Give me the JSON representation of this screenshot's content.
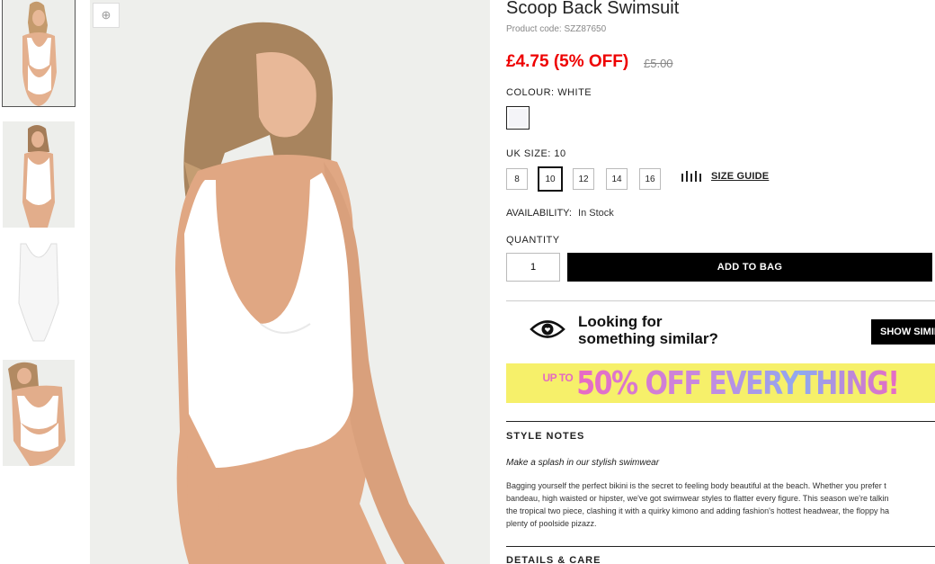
{
  "gallery": {
    "thumbnails": [
      {
        "alt": "Back view"
      },
      {
        "alt": "Front view"
      },
      {
        "alt": "Flat lay"
      },
      {
        "alt": "Side back view"
      }
    ],
    "zoom_icon": "zoom-in-icon",
    "zoom_glyph": "⊕"
  },
  "product": {
    "title": "Scoop Back Swimsuit",
    "product_code": "Product code: SZZ87650",
    "price": "£4.75 (5% OFF)",
    "was_price": "£5.00",
    "colour_label": "COLOUR:",
    "colour_value": "WHITE",
    "size_label": "UK SIZE:",
    "size_value": "10",
    "sizes": [
      "8",
      "10",
      "12",
      "14",
      "16"
    ],
    "selected_size": "10",
    "size_guide": "SIZE GUIDE",
    "availability_label": "AVAILABILITY:",
    "availability_value": "In Stock",
    "quantity_label": "QUANTITY",
    "quantity_value": "1",
    "add_to_bag": "ADD TO BAG"
  },
  "similar": {
    "line1": "Looking for",
    "line2": "something similar?",
    "button": "SHOW SIMILAR"
  },
  "promo": {
    "up_to": "UP TO",
    "headline": "50% OFF EVERYTHING!"
  },
  "style_notes": {
    "heading": "STYLE NOTES",
    "tagline": "Make a splash in our stylish swimwear",
    "lines": [
      "Bagging yourself the perfect bikini is the secret to feeling body beautiful at the beach. Whether you prefer t",
      "bandeau, high waisted or hipster, we've got swimwear styles to flatter every figure. This season we're talkin",
      "the tropical two piece, clashing it with a quirky kimono and adding fashion's hottest headwear, the floppy ha",
      "plenty of poolside pizazz."
    ]
  },
  "details": {
    "heading": "DETAILS & CARE"
  },
  "colors": {
    "price_red": "#e00000",
    "button_black": "#000000",
    "promo_yellow": "#f6f06a",
    "promo_pink": "#e86ac4"
  }
}
